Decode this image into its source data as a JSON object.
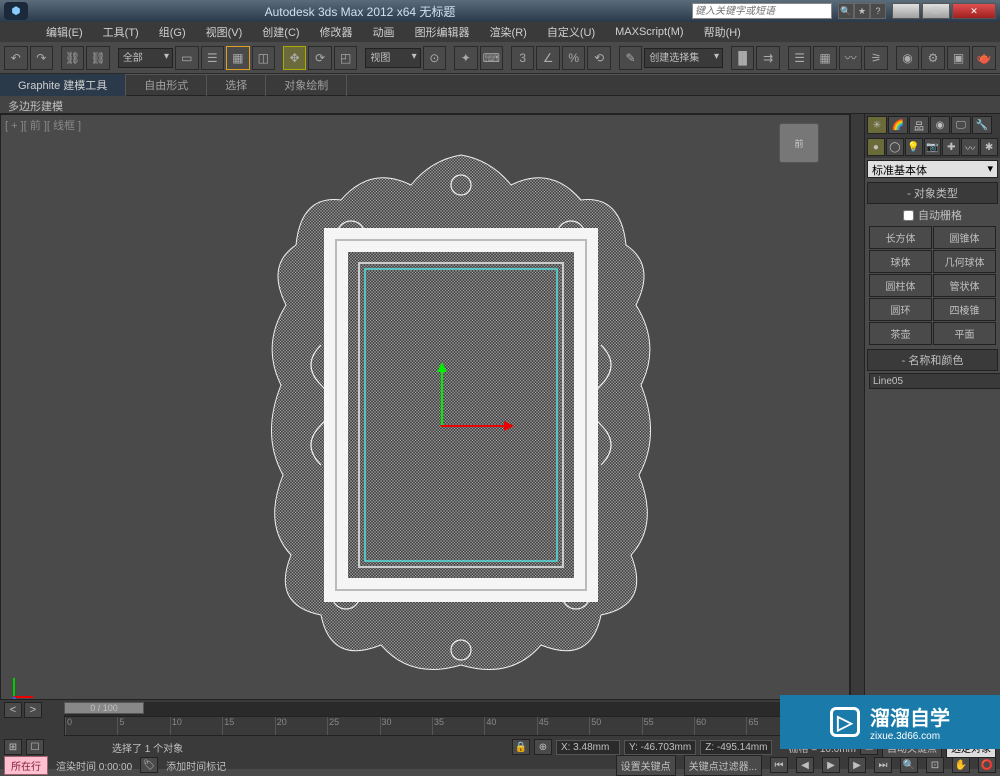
{
  "app": {
    "title": "Autodesk 3ds Max 2012 x64   无标题",
    "search_placeholder": "键入关键字或短语"
  },
  "menu": {
    "items": [
      "编辑(E)",
      "工具(T)",
      "组(G)",
      "视图(V)",
      "创建(C)",
      "修改器",
      "动画",
      "图形编辑器",
      "渲染(R)",
      "自定义(U)",
      "MAXScript(M)",
      "帮助(H)"
    ]
  },
  "toolbar": {
    "filter_dd": "全部",
    "view_dd": "视图",
    "create_set": "创建选择集"
  },
  "ribbon": {
    "tab_active": "Graphite 建模工具",
    "tabs": [
      "自由形式",
      "选择",
      "对象绘制"
    ],
    "sub": "多边形建模"
  },
  "viewport": {
    "label": "[ + ][ 前 ][ 线框 ]",
    "cube": "前"
  },
  "cmd": {
    "dropdown": "标准基本体",
    "rollout_type": "对象类型",
    "autogrid": "自动栅格",
    "buttons": [
      "长方体",
      "圆锥体",
      "球体",
      "几何球体",
      "圆柱体",
      "管状体",
      "圆环",
      "四棱锥",
      "茶壶",
      "平面"
    ],
    "rollout_name": "名称和颜色",
    "obj_name": "Line05"
  },
  "timeline": {
    "slider": "0 / 100",
    "ticks": [
      "0",
      "5",
      "10",
      "15",
      "20",
      "25",
      "30",
      "35",
      "40",
      "45",
      "50",
      "55",
      "60",
      "65"
    ]
  },
  "status": {
    "selection": "选择了 1 个对象",
    "x": "X:  3.48mm",
    "y": "Y:  -46.703mm",
    "z": "Z:  -495.14mm",
    "grid": "栅格 = 10.0mm",
    "autokey": "自动关键点",
    "selset": "选定对象",
    "prompt_btn": "所在行",
    "render_time": "渲染时间   0:00:00",
    "add_time_tag": "添加时间标记",
    "set_key": "设置关键点",
    "key_filter": "关键点过滤器..."
  },
  "watermark": {
    "text": "溜溜自学",
    "sub": "zixue.3d66.com"
  }
}
